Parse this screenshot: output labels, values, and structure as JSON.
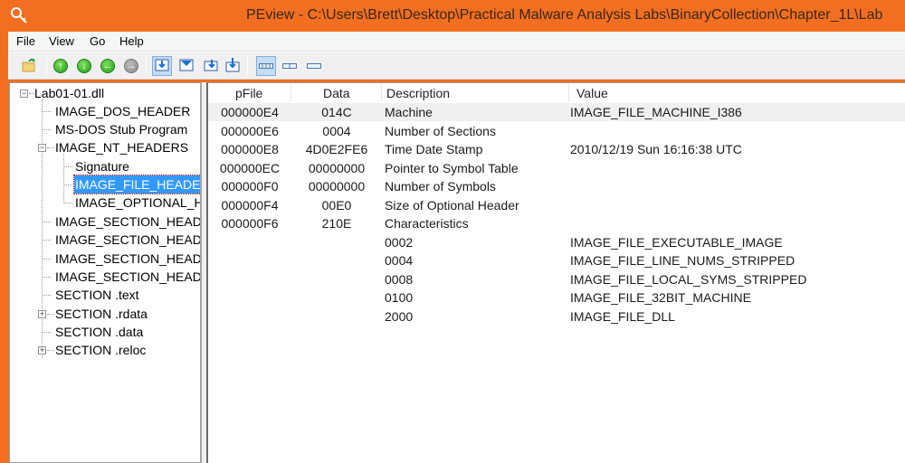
{
  "window": {
    "title": "PEview - C:\\Users\\Brett\\Desktop\\Practical Malware Analysis Labs\\BinaryCollection\\Chapter_1L\\Lab",
    "accent_color": "#f26f21",
    "app_icon": "magnifier-key-icon"
  },
  "menu": {
    "items": [
      {
        "label": "File"
      },
      {
        "label": "View"
      },
      {
        "label": "Go"
      },
      {
        "label": "Help"
      }
    ]
  },
  "toolbar": {
    "buttons": [
      {
        "name": "open-file",
        "icon": "open-folder-icon"
      },
      {
        "name": "go-up",
        "icon": "arrow-up-circle-icon"
      },
      {
        "name": "go-down",
        "icon": "arrow-down-circle-icon"
      },
      {
        "name": "go-back",
        "icon": "arrow-left-circle-icon"
      },
      {
        "name": "go-forward",
        "icon": "arrow-right-circle-icon",
        "disabled": true
      },
      {
        "name": "view-byte",
        "icon": "view-byte-icon",
        "active": true
      },
      {
        "name": "view-word",
        "icon": "view-word-icon"
      },
      {
        "name": "view-dword",
        "icon": "view-dword-icon"
      },
      {
        "name": "view-qword",
        "icon": "view-qword-icon"
      },
      {
        "name": "hex-view-wide",
        "icon": "hex-wide-icon",
        "active": true
      },
      {
        "name": "hex-view-medium",
        "icon": "hex-medium-icon"
      },
      {
        "name": "hex-view-narrow",
        "icon": "hex-narrow-icon"
      }
    ]
  },
  "tree": {
    "root": "Lab01-01.dll",
    "items": [
      {
        "label": "Lab01-01.dll",
        "level": 0,
        "expander": "minus"
      },
      {
        "label": "IMAGE_DOS_HEADER",
        "level": 1
      },
      {
        "label": "MS-DOS Stub Program",
        "level": 1
      },
      {
        "label": "IMAGE_NT_HEADERS",
        "level": 1,
        "expander": "minus"
      },
      {
        "label": "Signature",
        "level": 2
      },
      {
        "label": "IMAGE_FILE_HEADER",
        "level": 2,
        "selected": true
      },
      {
        "label": "IMAGE_OPTIONAL_HEADER",
        "level": 2
      },
      {
        "label": "IMAGE_SECTION_HEADER .text",
        "level": 1
      },
      {
        "label": "IMAGE_SECTION_HEADER .rdata",
        "level": 1
      },
      {
        "label": "IMAGE_SECTION_HEADER .data",
        "level": 1
      },
      {
        "label": "IMAGE_SECTION_HEADER .reloc",
        "level": 1
      },
      {
        "label": "SECTION .text",
        "level": 1
      },
      {
        "label": "SECTION .rdata",
        "level": 1,
        "expander": "plus"
      },
      {
        "label": "SECTION .data",
        "level": 1
      },
      {
        "label": "SECTION .reloc",
        "level": 1,
        "expander": "plus"
      }
    ]
  },
  "table": {
    "columns": [
      "pFile",
      "Data",
      "Description",
      "Value"
    ],
    "rows": [
      {
        "pFile": "000000E4",
        "data": "014C",
        "description": "Machine",
        "value": "IMAGE_FILE_MACHINE_I386",
        "highlight": true
      },
      {
        "pFile": "000000E6",
        "data": "0004",
        "description": "Number of Sections",
        "value": ""
      },
      {
        "pFile": "000000E8",
        "data": "4D0E2FE6",
        "description": "Time Date Stamp",
        "value": "2010/12/19 Sun 16:16:38 UTC"
      },
      {
        "pFile": "000000EC",
        "data": "00000000",
        "description": "Pointer to Symbol Table",
        "value": ""
      },
      {
        "pFile": "000000F0",
        "data": "00000000",
        "description": "Number of Symbols",
        "value": ""
      },
      {
        "pFile": "000000F4",
        "data": "00E0",
        "description": "Size of Optional Header",
        "value": ""
      },
      {
        "pFile": "000000F6",
        "data": "210E",
        "description": "Characteristics",
        "value": ""
      },
      {
        "pFile": "",
        "data": "",
        "description": "0002",
        "value": "IMAGE_FILE_EXECUTABLE_IMAGE"
      },
      {
        "pFile": "",
        "data": "",
        "description": "0004",
        "value": "IMAGE_FILE_LINE_NUMS_STRIPPED"
      },
      {
        "pFile": "",
        "data": "",
        "description": "0008",
        "value": "IMAGE_FILE_LOCAL_SYMS_STRIPPED"
      },
      {
        "pFile": "",
        "data": "",
        "description": "0100",
        "value": "IMAGE_FILE_32BIT_MACHINE"
      },
      {
        "pFile": "",
        "data": "",
        "description": "2000",
        "value": "IMAGE_FILE_DLL"
      }
    ]
  }
}
